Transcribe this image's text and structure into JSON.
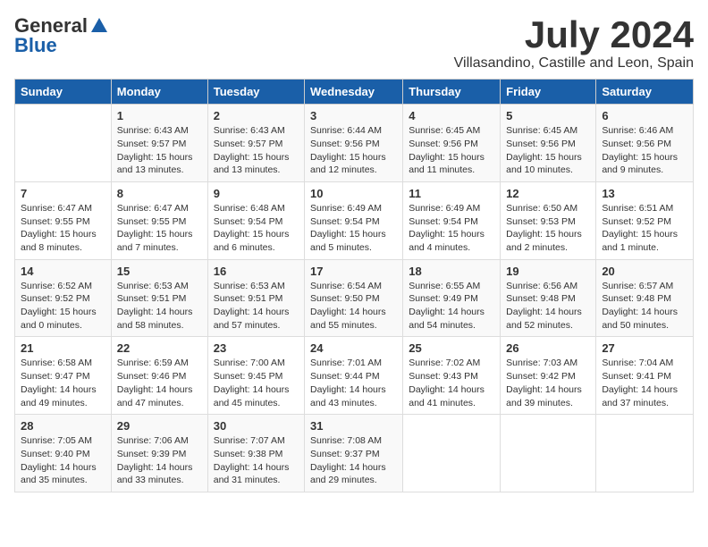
{
  "logo": {
    "general": "General",
    "blue": "Blue"
  },
  "title": {
    "month_year": "July 2024",
    "location": "Villasandino, Castille and Leon, Spain"
  },
  "weekdays": [
    "Sunday",
    "Monday",
    "Tuesday",
    "Wednesday",
    "Thursday",
    "Friday",
    "Saturday"
  ],
  "weeks": [
    [
      {
        "day": "",
        "info": ""
      },
      {
        "day": "1",
        "info": "Sunrise: 6:43 AM\nSunset: 9:57 PM\nDaylight: 15 hours\nand 13 minutes."
      },
      {
        "day": "2",
        "info": "Sunrise: 6:43 AM\nSunset: 9:57 PM\nDaylight: 15 hours\nand 13 minutes."
      },
      {
        "day": "3",
        "info": "Sunrise: 6:44 AM\nSunset: 9:56 PM\nDaylight: 15 hours\nand 12 minutes."
      },
      {
        "day": "4",
        "info": "Sunrise: 6:45 AM\nSunset: 9:56 PM\nDaylight: 15 hours\nand 11 minutes."
      },
      {
        "day": "5",
        "info": "Sunrise: 6:45 AM\nSunset: 9:56 PM\nDaylight: 15 hours\nand 10 minutes."
      },
      {
        "day": "6",
        "info": "Sunrise: 6:46 AM\nSunset: 9:56 PM\nDaylight: 15 hours\nand 9 minutes."
      }
    ],
    [
      {
        "day": "7",
        "info": "Sunrise: 6:47 AM\nSunset: 9:55 PM\nDaylight: 15 hours\nand 8 minutes."
      },
      {
        "day": "8",
        "info": "Sunrise: 6:47 AM\nSunset: 9:55 PM\nDaylight: 15 hours\nand 7 minutes."
      },
      {
        "day": "9",
        "info": "Sunrise: 6:48 AM\nSunset: 9:54 PM\nDaylight: 15 hours\nand 6 minutes."
      },
      {
        "day": "10",
        "info": "Sunrise: 6:49 AM\nSunset: 9:54 PM\nDaylight: 15 hours\nand 5 minutes."
      },
      {
        "day": "11",
        "info": "Sunrise: 6:49 AM\nSunset: 9:54 PM\nDaylight: 15 hours\nand 4 minutes."
      },
      {
        "day": "12",
        "info": "Sunrise: 6:50 AM\nSunset: 9:53 PM\nDaylight: 15 hours\nand 2 minutes."
      },
      {
        "day": "13",
        "info": "Sunrise: 6:51 AM\nSunset: 9:52 PM\nDaylight: 15 hours\nand 1 minute."
      }
    ],
    [
      {
        "day": "14",
        "info": "Sunrise: 6:52 AM\nSunset: 9:52 PM\nDaylight: 15 hours\nand 0 minutes."
      },
      {
        "day": "15",
        "info": "Sunrise: 6:53 AM\nSunset: 9:51 PM\nDaylight: 14 hours\nand 58 minutes."
      },
      {
        "day": "16",
        "info": "Sunrise: 6:53 AM\nSunset: 9:51 PM\nDaylight: 14 hours\nand 57 minutes."
      },
      {
        "day": "17",
        "info": "Sunrise: 6:54 AM\nSunset: 9:50 PM\nDaylight: 14 hours\nand 55 minutes."
      },
      {
        "day": "18",
        "info": "Sunrise: 6:55 AM\nSunset: 9:49 PM\nDaylight: 14 hours\nand 54 minutes."
      },
      {
        "day": "19",
        "info": "Sunrise: 6:56 AM\nSunset: 9:48 PM\nDaylight: 14 hours\nand 52 minutes."
      },
      {
        "day": "20",
        "info": "Sunrise: 6:57 AM\nSunset: 9:48 PM\nDaylight: 14 hours\nand 50 minutes."
      }
    ],
    [
      {
        "day": "21",
        "info": "Sunrise: 6:58 AM\nSunset: 9:47 PM\nDaylight: 14 hours\nand 49 minutes."
      },
      {
        "day": "22",
        "info": "Sunrise: 6:59 AM\nSunset: 9:46 PM\nDaylight: 14 hours\nand 47 minutes."
      },
      {
        "day": "23",
        "info": "Sunrise: 7:00 AM\nSunset: 9:45 PM\nDaylight: 14 hours\nand 45 minutes."
      },
      {
        "day": "24",
        "info": "Sunrise: 7:01 AM\nSunset: 9:44 PM\nDaylight: 14 hours\nand 43 minutes."
      },
      {
        "day": "25",
        "info": "Sunrise: 7:02 AM\nSunset: 9:43 PM\nDaylight: 14 hours\nand 41 minutes."
      },
      {
        "day": "26",
        "info": "Sunrise: 7:03 AM\nSunset: 9:42 PM\nDaylight: 14 hours\nand 39 minutes."
      },
      {
        "day": "27",
        "info": "Sunrise: 7:04 AM\nSunset: 9:41 PM\nDaylight: 14 hours\nand 37 minutes."
      }
    ],
    [
      {
        "day": "28",
        "info": "Sunrise: 7:05 AM\nSunset: 9:40 PM\nDaylight: 14 hours\nand 35 minutes."
      },
      {
        "day": "29",
        "info": "Sunrise: 7:06 AM\nSunset: 9:39 PM\nDaylight: 14 hours\nand 33 minutes."
      },
      {
        "day": "30",
        "info": "Sunrise: 7:07 AM\nSunset: 9:38 PM\nDaylight: 14 hours\nand 31 minutes."
      },
      {
        "day": "31",
        "info": "Sunrise: 7:08 AM\nSunset: 9:37 PM\nDaylight: 14 hours\nand 29 minutes."
      },
      {
        "day": "",
        "info": ""
      },
      {
        "day": "",
        "info": ""
      },
      {
        "day": "",
        "info": ""
      }
    ]
  ]
}
